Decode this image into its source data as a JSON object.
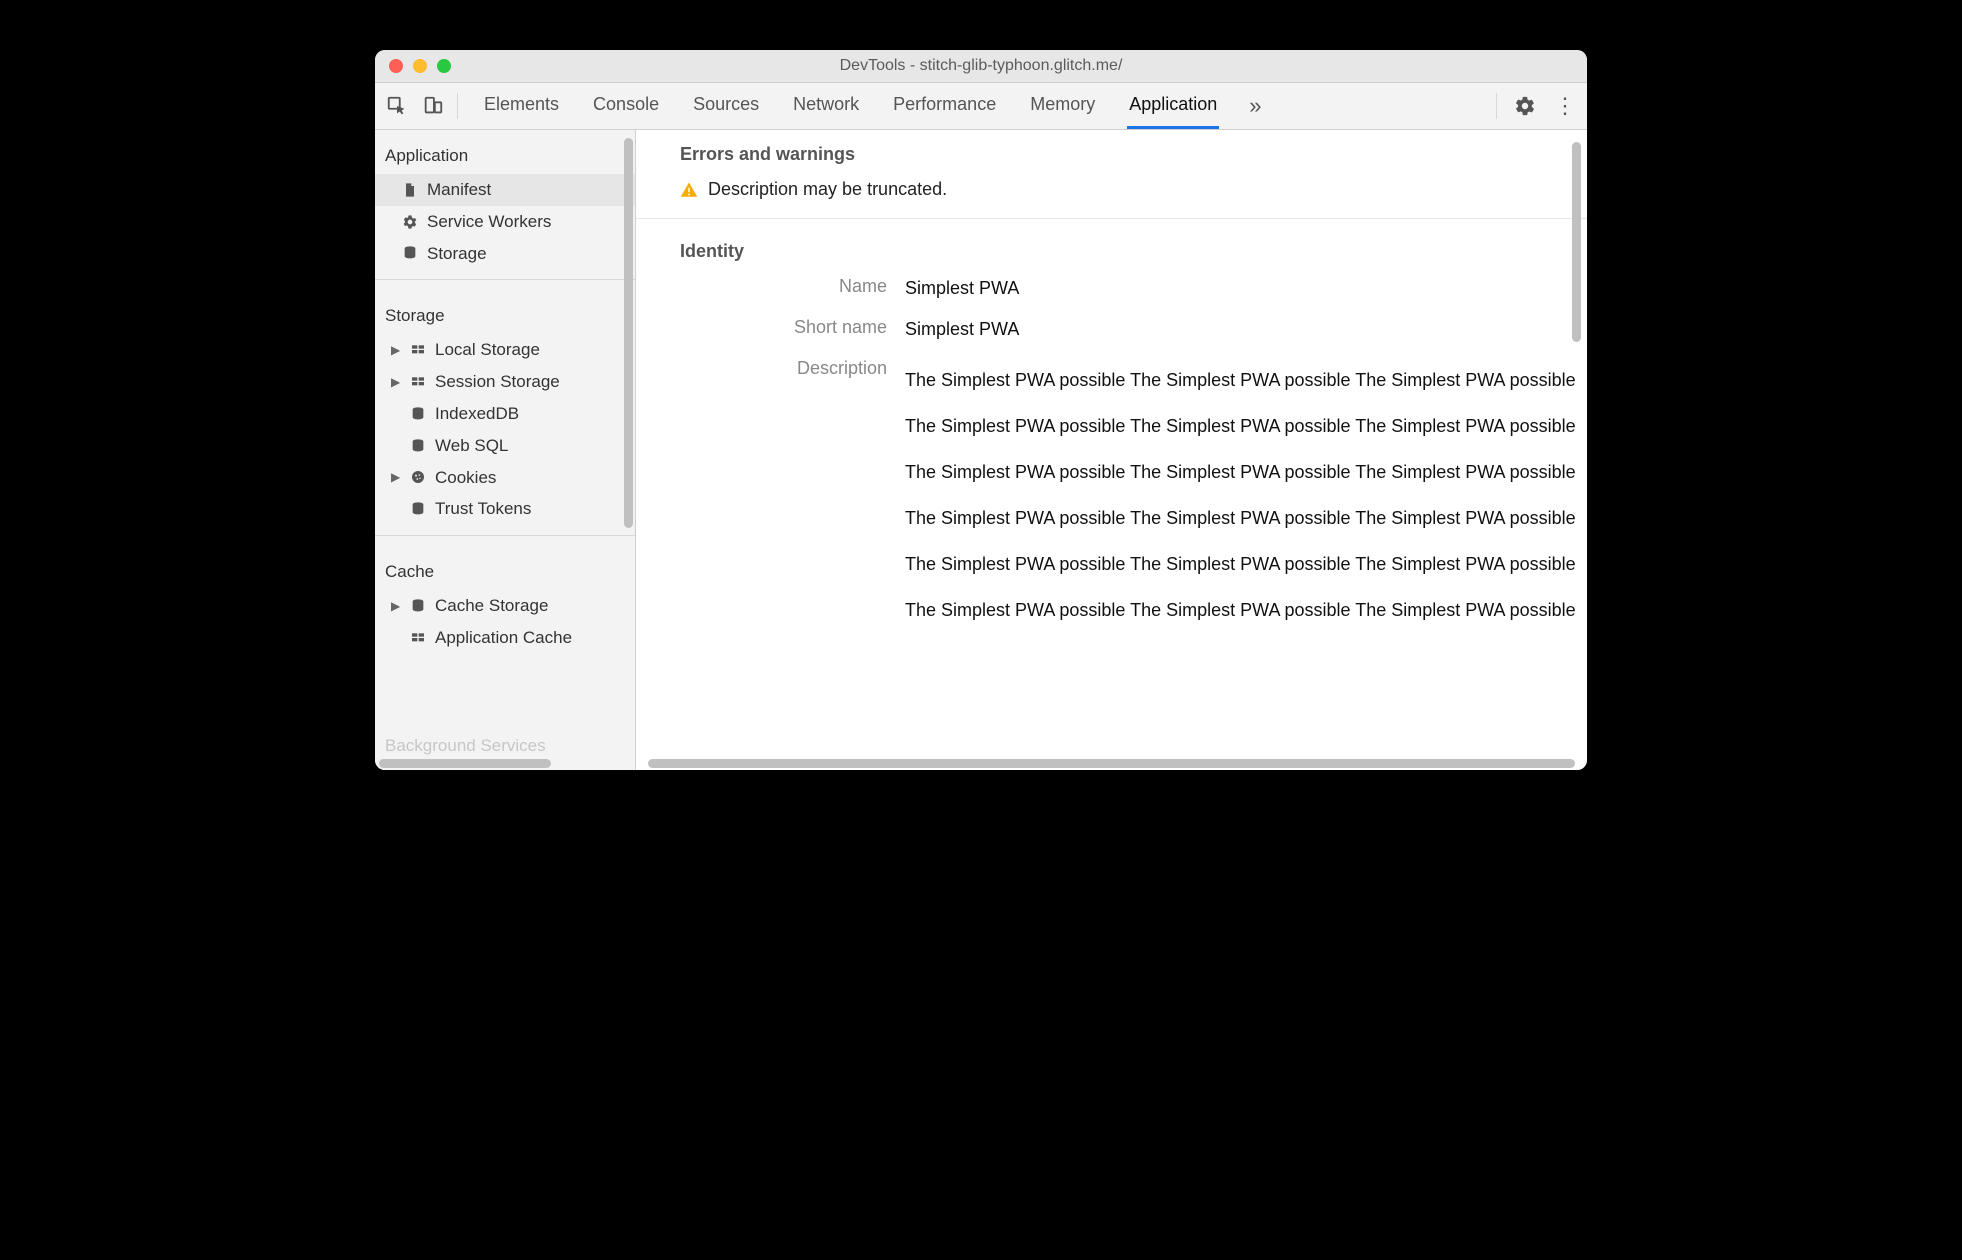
{
  "window": {
    "title": "DevTools - stitch-glib-typhoon.glitch.me/"
  },
  "toolbar": {
    "tabs": [
      {
        "id": "elements",
        "label": "Elements"
      },
      {
        "id": "console",
        "label": "Console"
      },
      {
        "id": "sources",
        "label": "Sources"
      },
      {
        "id": "network",
        "label": "Network"
      },
      {
        "id": "performance",
        "label": "Performance"
      },
      {
        "id": "memory",
        "label": "Memory"
      },
      {
        "id": "application",
        "label": "Application"
      }
    ],
    "activeTab": "application"
  },
  "sidebar": {
    "sections": [
      {
        "title": "Application",
        "items": [
          {
            "icon": "file",
            "label": "Manifest",
            "selected": true
          },
          {
            "icon": "gear",
            "label": "Service Workers"
          },
          {
            "icon": "db",
            "label": "Storage"
          }
        ]
      },
      {
        "title": "Storage",
        "items": [
          {
            "icon": "grid",
            "label": "Local Storage",
            "expandable": true
          },
          {
            "icon": "grid",
            "label": "Session Storage",
            "expandable": true
          },
          {
            "icon": "db",
            "label": "IndexedDB"
          },
          {
            "icon": "db",
            "label": "Web SQL"
          },
          {
            "icon": "cookie",
            "label": "Cookies",
            "expandable": true
          },
          {
            "icon": "db",
            "label": "Trust Tokens"
          }
        ]
      },
      {
        "title": "Cache",
        "items": [
          {
            "icon": "db",
            "label": "Cache Storage",
            "expandable": true
          },
          {
            "icon": "grid",
            "label": "Application Cache"
          }
        ]
      }
    ],
    "faded_title": "Background Services"
  },
  "main": {
    "errors_heading": "Errors and warnings",
    "warning_text": "Description may be truncated.",
    "identity_heading": "Identity",
    "identity": {
      "name_label": "Name",
      "name_value": "Simplest PWA",
      "short_name_label": "Short name",
      "short_name_value": "Simplest PWA",
      "description_label": "Description",
      "description_value": "The Simplest PWA possible The Simplest PWA possible The Simplest PWA possible The Simplest PWA possible The Simplest PWA possible The Simplest PWA possible The Simplest PWA possible The Simplest PWA possible The Simplest PWA possible The Simplest PWA possible The Simplest PWA possible The Simplest PWA possible The Simplest PWA possible The Simplest PWA possible The Simplest PWA possible The Simplest PWA possible The Simplest PWA possible The Simplest PWA possible"
    }
  }
}
